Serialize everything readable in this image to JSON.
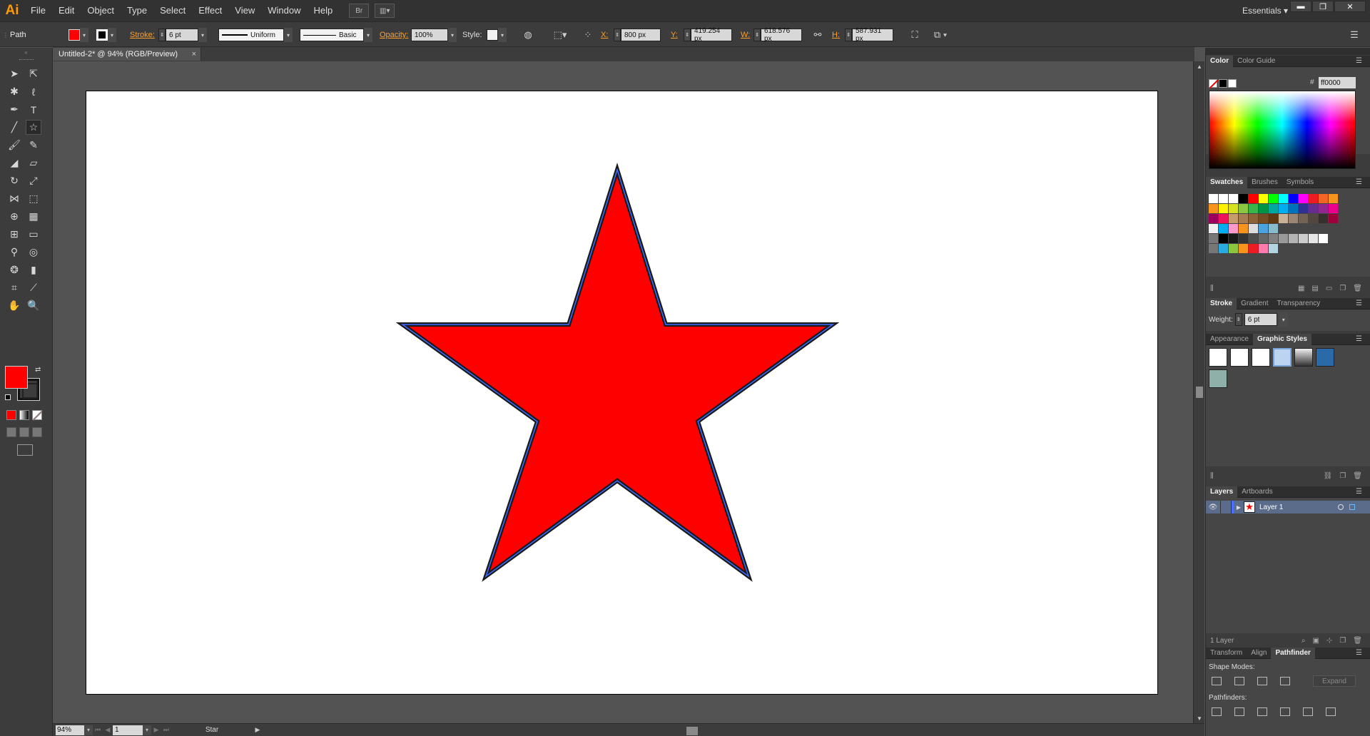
{
  "app": {
    "logo": "Ai",
    "workspace": "Essentials"
  },
  "menu": [
    "File",
    "Edit",
    "Object",
    "Type",
    "Select",
    "Effect",
    "View",
    "Window",
    "Help"
  ],
  "menu_icons": {
    "bridge": "Br",
    "arrange": "▥▾"
  },
  "window_buttons": {
    "minimize": "▬",
    "restore": "❐",
    "close": "✕"
  },
  "control": {
    "selection": "Path",
    "stroke_label": "Stroke:",
    "stroke_weight": "6 pt",
    "profile": "Uniform",
    "brush": "Basic",
    "opacity_label": "Opacity:",
    "opacity": "100%",
    "style_label": "Style:",
    "x_label": "X:",
    "x": "800 px",
    "y_label": "Y:",
    "y": "419.254 px",
    "w_label": "W:",
    "w": "618.576 px",
    "h_label": "H:",
    "h": "587.931 px",
    "fill_color": "#ff0000"
  },
  "document": {
    "tab": "Untitled-2* @ 94% (RGB/Preview)",
    "close": "×"
  },
  "status": {
    "zoom": "94%",
    "page": "1",
    "tool": "Star"
  },
  "panels": {
    "color": {
      "tabs": [
        "Color",
        "Color Guide"
      ],
      "hash": "#",
      "hex": "ff0000"
    },
    "swatches": {
      "tabs": [
        "Swatches",
        "Brushes",
        "Symbols"
      ]
    },
    "stroke": {
      "tabs": [
        "Stroke",
        "Gradient",
        "Transparency"
      ],
      "weight_label": "Weight:",
      "weight": "6 pt"
    },
    "styles": {
      "tabs": [
        "Appearance",
        "Graphic Styles"
      ]
    },
    "layers": {
      "tabs": [
        "Layers",
        "Artboards"
      ],
      "layer_name": "Layer 1",
      "count": "1 Layer"
    },
    "pathfinder": {
      "tabs": [
        "Transform",
        "Align",
        "Pathfinder"
      ],
      "shape_modes": "Shape Modes:",
      "pathfinders": "Pathfinders:",
      "expand": "Expand"
    }
  },
  "swatch_rows": [
    [
      "#ffffff",
      "#ffffff",
      "#ffffff",
      "#000000",
      "#ff0000",
      "#ffff00",
      "#00ff00",
      "#00ffff",
      "#0000ff",
      "#ff00ff",
      "#ed1c24",
      "#f26522",
      "#f7941d"
    ],
    [
      "#f7941d",
      "#fff200",
      "#d7e021",
      "#8dc63f",
      "#39b54a",
      "#009444",
      "#00a99d",
      "#00aeef",
      "#0072bc",
      "#2e3192",
      "#662d91",
      "#92278f",
      "#ec008c"
    ],
    [
      "#9e005d",
      "#ed145b",
      "#c69c6d",
      "#a67c52",
      "#8c6239",
      "#754c24",
      "#603913",
      "#c7b299",
      "#998675",
      "#736357",
      "#534741",
      "#362f2d",
      "#9e0039"
    ],
    [
      "#f0f0f0",
      "#00aeef",
      "#ff99cc",
      "#f7941d",
      "#dddddd",
      "#4aa3df",
      "#88bbcc"
    ],
    [
      "#777777",
      "#000000",
      "#1a1a1a",
      "#333333",
      "#4d4d4d",
      "#666666",
      "#808080",
      "#999999",
      "#b3b3b3",
      "#cccccc",
      "#e6e6e6",
      "#ffffff"
    ],
    [
      "#777777",
      "#29abe2",
      "#8cc63f",
      "#f7931e",
      "#ed1c24",
      "#ff7bac",
      "#b3d4e0"
    ]
  ],
  "star": {
    "fill": "#ff0000",
    "stroke": "#1a1a1a",
    "path_color": "#3d6bff"
  }
}
